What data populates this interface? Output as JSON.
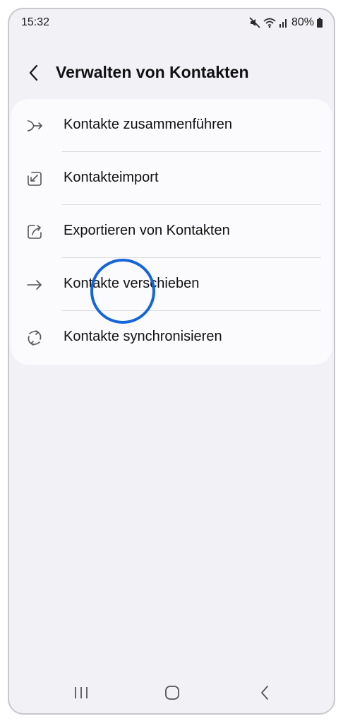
{
  "status_bar": {
    "time": "15:32",
    "battery": "80%",
    "icons": [
      "mute-icon",
      "wifi-icon",
      "signal-icon",
      "battery-icon"
    ]
  },
  "header": {
    "back_icon": "chevron-left-icon",
    "title": "Verwalten von Kontakten"
  },
  "menu": {
    "items": [
      {
        "label": "Kontakte zusammenführen",
        "icon": "merge-icon"
      },
      {
        "label": "Kontakteimport",
        "icon": "import-icon"
      },
      {
        "label": "Exportieren von Kontakten",
        "icon": "export-icon"
      },
      {
        "label": "Kontakte verschieben",
        "icon": "arrow-right-icon"
      },
      {
        "label": "Kontakte synchronisieren",
        "icon": "sync-icon"
      }
    ]
  },
  "nav_bar": {
    "icons": [
      "recents-icon",
      "home-icon",
      "back-icon"
    ]
  },
  "colors": {
    "background": "#f2f2f6",
    "card": "#fbfbfd",
    "highlight": "#1565d8"
  }
}
